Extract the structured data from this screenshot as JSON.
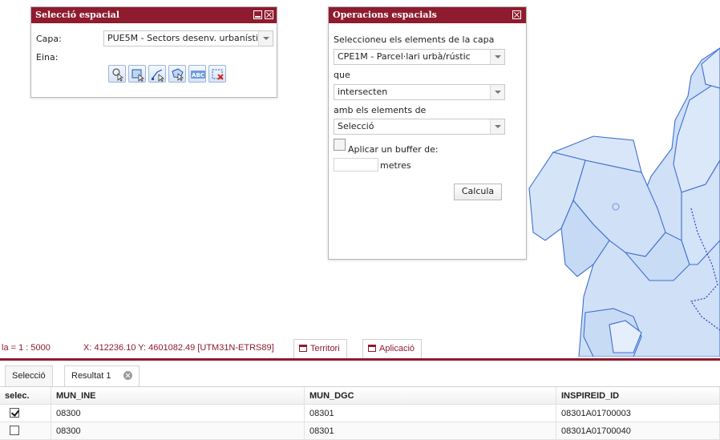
{
  "panel_selection": {
    "title": "Selecció espacial",
    "capa_label": "Capa:",
    "capa_value": "PUE5M - Sectors desenv. urbanísti",
    "eina_label": "Eina:",
    "tools": [
      "pointer-select-icon",
      "rectangle-select-icon",
      "line-select-icon",
      "polygon-select-icon",
      "text-select-icon",
      "clear-selection-icon"
    ],
    "tool_text": "ABC"
  },
  "panel_operations": {
    "title": "Operacions espacials",
    "select_label": "Seleccioneu els elements de la capa",
    "layer_value": "CPE1M - Parcel·lari urbà/rústic",
    "que_label": "que",
    "relation_value": "intersecten",
    "amb_label": "amb els elements de",
    "source_value": "Selecció",
    "buffer_label": "Aplicar un buffer de:",
    "buffer_value": "",
    "buffer_unit": "metres",
    "calc_button": "Calcula"
  },
  "statusbar": {
    "scale": "la = 1 : 5000",
    "coords": "X: 412236.10 Y: 4601082.49 [UTM31N-ETRS89]",
    "territori": "Territori",
    "aplicacio": "Aplicació"
  },
  "tabs": [
    {
      "label": "Selecció"
    },
    {
      "label": "Resultat 1"
    }
  ],
  "table": {
    "columns": [
      "selec.",
      "MUN_INE",
      "MUN_DGC",
      "INSPIREID_ID"
    ],
    "rows": [
      {
        "checked": true,
        "MUN_INE": "08300",
        "MUN_DGC": "08301",
        "INSPIREID_ID": "08301A01700003"
      },
      {
        "checked": false,
        "MUN_INE": "08300",
        "MUN_DGC": "08301",
        "INSPIREID_ID": "08301A01700040"
      }
    ]
  },
  "colors": {
    "accent": "#8e1b2e",
    "parcel_fill": "#cfe0f7",
    "parcel_stroke": "#3d6fd1"
  }
}
